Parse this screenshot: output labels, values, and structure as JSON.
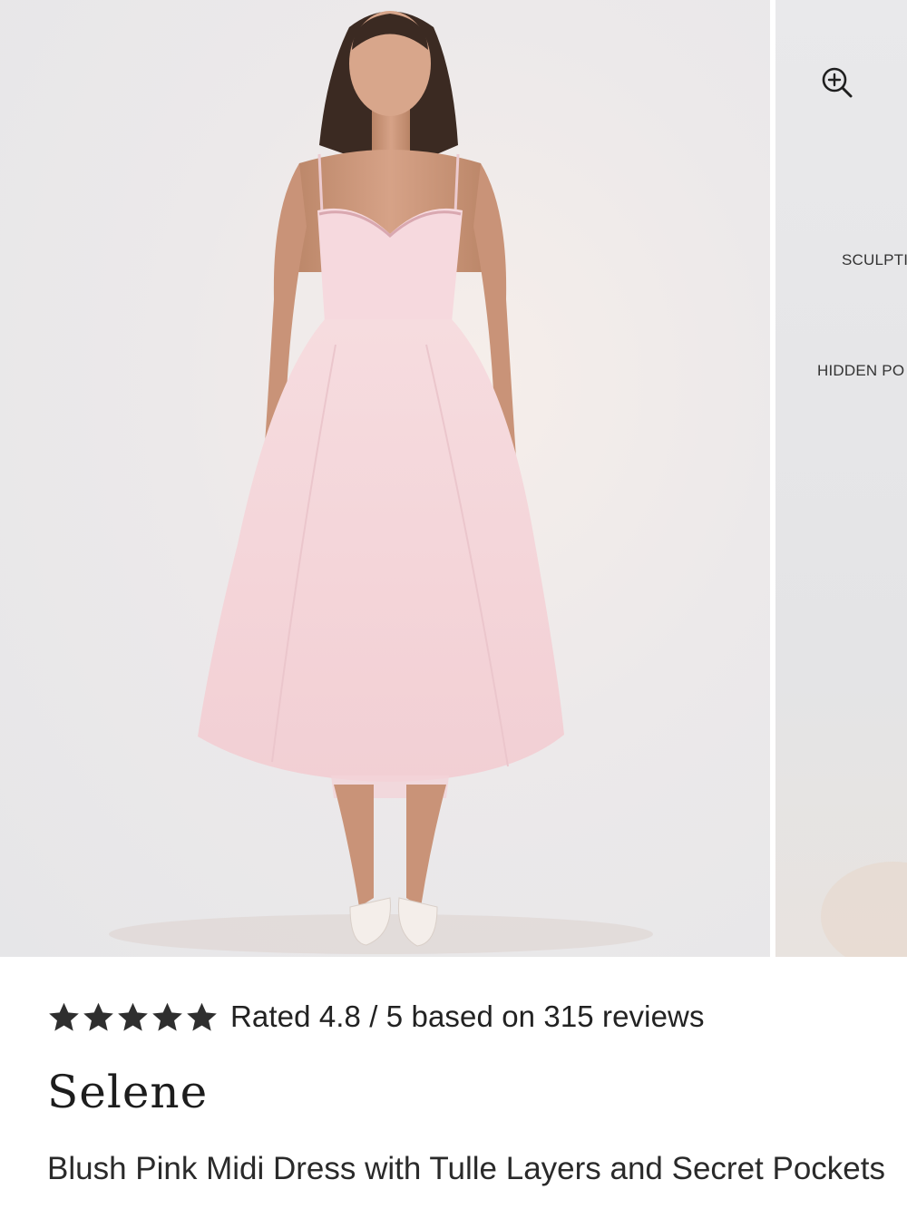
{
  "gallery": {
    "main_image_alt": "Model wearing blush pink midi dress",
    "next_slide": {
      "callouts": [
        "SCULPTI",
        "HIDDEN PO"
      ]
    },
    "zoom_icon": "zoom-in-icon"
  },
  "product": {
    "rating": {
      "stars_filled": 5,
      "stars_total": 5,
      "text": "Rated 4.8 / 5 based on 315 reviews"
    },
    "name": "Selene",
    "subtitle": "Blush Pink Midi Dress with Tulle Layers and Secret Pockets"
  },
  "colors": {
    "dress": "#f5d6db",
    "star": "#2f2f2f",
    "text": "#222222"
  }
}
